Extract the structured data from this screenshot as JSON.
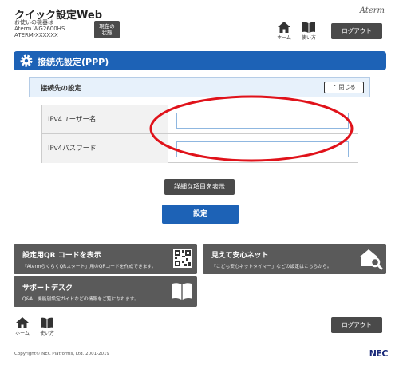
{
  "header": {
    "app_title": "クイック設定Web",
    "device_caption": "お使いの機器は",
    "device_model": "Aterm WG2600HS",
    "device_name": "ATERM-XXXXXX",
    "status_button": "現在の\n状態",
    "brand_logo": "Aterm",
    "home_label": "ホーム",
    "help_label": "使い方",
    "logout_label": "ログアウト"
  },
  "section": {
    "title": "接続先設定(PPP)"
  },
  "panel": {
    "title": "接続先の設定",
    "collapse_label": "閉じる"
  },
  "form": {
    "rows": [
      {
        "label": "IPv4ユーザー名",
        "value": "",
        "placeholder": ""
      },
      {
        "label": "IPv4パスワード",
        "value": "",
        "placeholder": ""
      }
    ]
  },
  "actions": {
    "detail_label": "詳細な項目を表示",
    "set_label": "設定"
  },
  "tiles": {
    "qr": {
      "title": "設定用QR コードを表示",
      "desc": "「AtermらくらくQRスタート」用のQRコードを作成できます。"
    },
    "safe": {
      "title": "見えて安心ネット",
      "desc": "「こども安心ネットタイマー」などの設定はこちらから。"
    },
    "support": {
      "title": "サポートデスク",
      "desc": "Q&A、機能別設定ガイドなどの情報をご覧になれます。"
    }
  },
  "footer": {
    "home_label": "ホーム",
    "help_label": "使い方",
    "logout_label": "ログアウト",
    "copyright": "Copyright© NEC Platforms, Ltd. 2001-2019",
    "nec_logo": "NEC"
  },
  "colors": {
    "primary_blue": "#1d62b6",
    "dark_button": "#4a4a4a",
    "tile_gray": "#5a5a5a",
    "annotation_red": "#e0121a"
  }
}
